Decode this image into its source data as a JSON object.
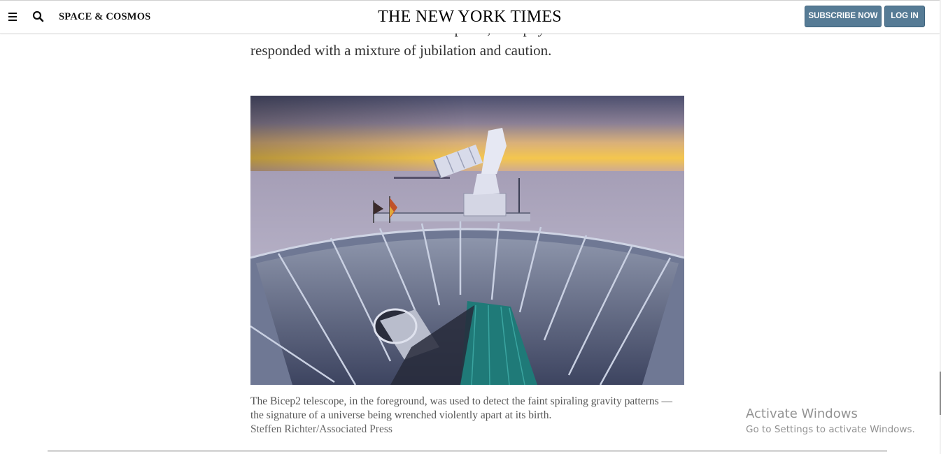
{
  "header": {
    "menu_icon": "hamburger-menu-icon",
    "search_icon": "search-icon",
    "section": "SPACE & COSMOS",
    "masthead": "THE NEW YORK TIMES",
    "subscribe_label": "SUBSCRIBE NOW",
    "login_label": "LOG IN",
    "button_color": "#567b95"
  },
  "article": {
    "paragraph_lines": [
      "inflation had been seen and news spread, astrophysicists",
      "responded with a mixture of jubilation and caution."
    ],
    "image": {
      "subject": "Bicep2 telescope dish at the South Pole at dusk",
      "alt": "The Bicep2 telescope"
    },
    "caption": "The Bicep2 telescope, in the foreground, was used to detect the faint spiraling gravity patterns — the signature of a universe being wrenched violently apart at its birth.",
    "credit": "Steffen Richter/Associated Press"
  },
  "watermark": {
    "title": "Activate Windows",
    "subtitle": "Go to Settings to activate Windows."
  }
}
